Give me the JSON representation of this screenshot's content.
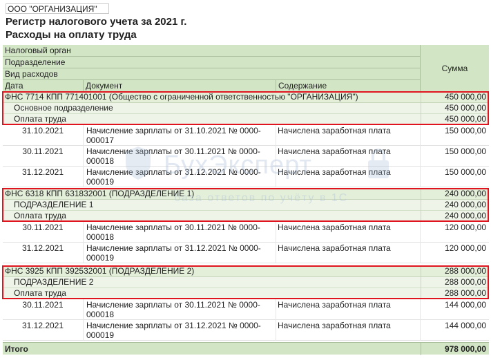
{
  "header": {
    "organization": "ООО \"ОРГАНИЗАЦИЯ\"",
    "title_line1": "Регистр налогового учета за 2021 г.",
    "title_line2": "Расходы на оплату труда"
  },
  "columns": {
    "tax_authority": "Налоговый орган",
    "subdivision": "Подразделение",
    "expense_type": "Вид расходов",
    "date": "Дата",
    "document": "Документ",
    "content": "Содержание",
    "sum": "Сумма"
  },
  "groups": [
    {
      "tax_authority": "ФНС 7714 КПП 771401001 (Общество с ограниченной ответственностью \"ОРГАНИЗАЦИЯ\")",
      "tax_amount": "450 000,00",
      "subdivision": "Основное подразделение",
      "subdivision_amount": "450 000,00",
      "expense_type": "Оплата труда",
      "expense_amount": "450 000,00",
      "rows": [
        {
          "date": "31.10.2021",
          "document": "Начисление зарплаты от 31.10.2021 № 0000-000017",
          "content": "Начислена заработная плата",
          "amount": "150 000,00"
        },
        {
          "date": "30.11.2021",
          "document": "Начисление зарплаты от 30.11.2021 № 0000-000018",
          "content": "Начислена заработная плата",
          "amount": "150 000,00"
        },
        {
          "date": "31.12.2021",
          "document": "Начисление зарплаты от 31.12.2021 № 0000-000019",
          "content": "Начислена заработная плата",
          "amount": "150 000,00"
        }
      ]
    },
    {
      "tax_authority": "ФНС 6318 КПП 631832001 (ПОДРАЗДЕЛЕНИЕ 1)",
      "tax_amount": "240 000,00",
      "subdivision": "ПОДРАЗДЕЛЕНИЕ 1",
      "subdivision_amount": "240 000,00",
      "expense_type": "Оплата труда",
      "expense_amount": "240 000,00",
      "rows": [
        {
          "date": "30.11.2021",
          "document": "Начисление зарплаты от 30.11.2021 № 0000-000018",
          "content": "Начислена заработная плата",
          "amount": "120 000,00"
        },
        {
          "date": "31.12.2021",
          "document": "Начисление зарплаты от 31.12.2021 № 0000-000019",
          "content": "Начислена заработная плата",
          "amount": "120 000,00"
        }
      ]
    },
    {
      "tax_authority": "ФНС 3925 КПП 392532001 (ПОДРАЗДЕЛЕНИЕ 2)",
      "tax_amount": "288 000,00",
      "subdivision": "ПОДРАЗДЕЛЕНИЕ 2",
      "subdivision_amount": "288 000,00",
      "expense_type": "Оплата труда",
      "expense_amount": "288 000,00",
      "rows": [
        {
          "date": "30.11.2021",
          "document": "Начисление зарплаты от 30.11.2021 № 0000-000018",
          "content": "Начислена заработная плата",
          "amount": "144 000,00"
        },
        {
          "date": "31.12.2021",
          "document": "Начисление зарплаты от 31.12.2021 № 0000-000019",
          "content": "Начислена заработная плата",
          "amount": "144 000,00"
        }
      ]
    }
  ],
  "total": {
    "label": "Итого",
    "amount": "978 000,00"
  },
  "watermark": {
    "title": "БухЭксперт",
    "subtitle": "база ответов по учёту в 1С"
  },
  "colors": {
    "header_bg": "#d2e6c5",
    "highlight": "#e0141e"
  }
}
